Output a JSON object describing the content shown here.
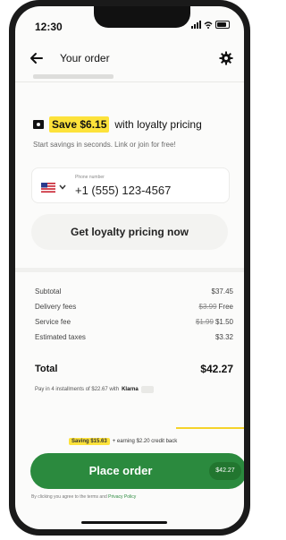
{
  "status_bar": {
    "time": "12:30"
  },
  "header": {
    "title": "Your order"
  },
  "loyalty": {
    "savings_label": "Save $6.15",
    "suffix": "with loyalty pricing",
    "subtitle": "Start savings in seconds. Link or join for free!",
    "phone_label": "Phone number",
    "phone_value": "+1 (555) 123-4567",
    "cta": "Get loyalty pricing now"
  },
  "summary": {
    "rows": [
      {
        "label": "Subtotal",
        "old": "",
        "value": "$37.45"
      },
      {
        "label": "Delivery fees",
        "old": "$3.99",
        "value": "Free"
      },
      {
        "label": "Service fee",
        "old": "$1.99",
        "value": "$1.50"
      },
      {
        "label": "Estimated taxes",
        "old": "",
        "value": "$3.32"
      }
    ],
    "total_label": "Total",
    "total_value": "$42.27"
  },
  "klarna": {
    "text": "Pay in 4 installments of $22.67 with",
    "brand": "Klarna"
  },
  "saving_banner": {
    "badge": "Saving $15.63",
    "text": "+ earning $2.20 credit back"
  },
  "place_order": {
    "label": "Place order",
    "total": "$42.27"
  },
  "legal": {
    "text": "By clicking you agree to the terms and",
    "link": "Privacy Policy"
  },
  "icons": {
    "back": "arrow-left-icon",
    "settings": "gear-icon",
    "loyalty": "tag-icon",
    "flag": "us-flag-icon",
    "dropdown": "chevron-down-icon"
  },
  "colors": {
    "accent": "#2b8a3e",
    "highlight": "#fde23a"
  }
}
